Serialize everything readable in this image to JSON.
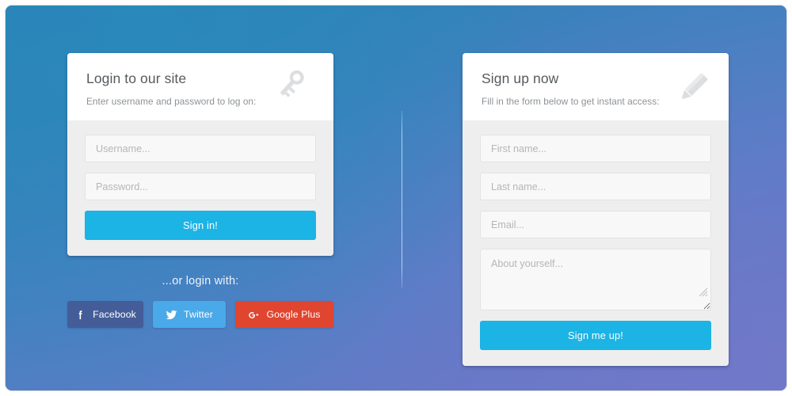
{
  "background": {
    "gradient_from": "#2b82b8",
    "gradient_to": "#6d7bc6"
  },
  "login": {
    "title": "Login to our site",
    "subtitle": "Enter username and password to log on:",
    "icon": "key-icon",
    "fields": [
      {
        "name": "username",
        "placeholder": "Username...",
        "value": "",
        "type": "text"
      },
      {
        "name": "password",
        "placeholder": "Password...",
        "value": "",
        "type": "password"
      }
    ],
    "submit_label": "Sign in!",
    "submit_color": "#1cb3e5"
  },
  "social": {
    "label": "...or login with:",
    "buttons": [
      {
        "name": "facebook",
        "label": "Facebook",
        "icon": "facebook-icon",
        "color": "#445d98"
      },
      {
        "name": "twitter",
        "label": "Twitter",
        "icon": "twitter-icon",
        "color": "#4aa9e8"
      },
      {
        "name": "googleplus",
        "label": "Google Plus",
        "icon": "google-plus-icon",
        "color": "#e0452f"
      }
    ]
  },
  "signup": {
    "title": "Sign up now",
    "subtitle": "Fill in the form below to get instant access:",
    "icon": "pencil-icon",
    "fields": [
      {
        "name": "first-name",
        "placeholder": "First name...",
        "value": "",
        "type": "text"
      },
      {
        "name": "last-name",
        "placeholder": "Last name...",
        "value": "",
        "type": "text"
      },
      {
        "name": "email",
        "placeholder": "Email...",
        "value": "",
        "type": "text"
      }
    ],
    "about_placeholder": "About yourself...",
    "about_value": "",
    "submit_label": "Sign me up!",
    "submit_color": "#1cb3e5"
  }
}
